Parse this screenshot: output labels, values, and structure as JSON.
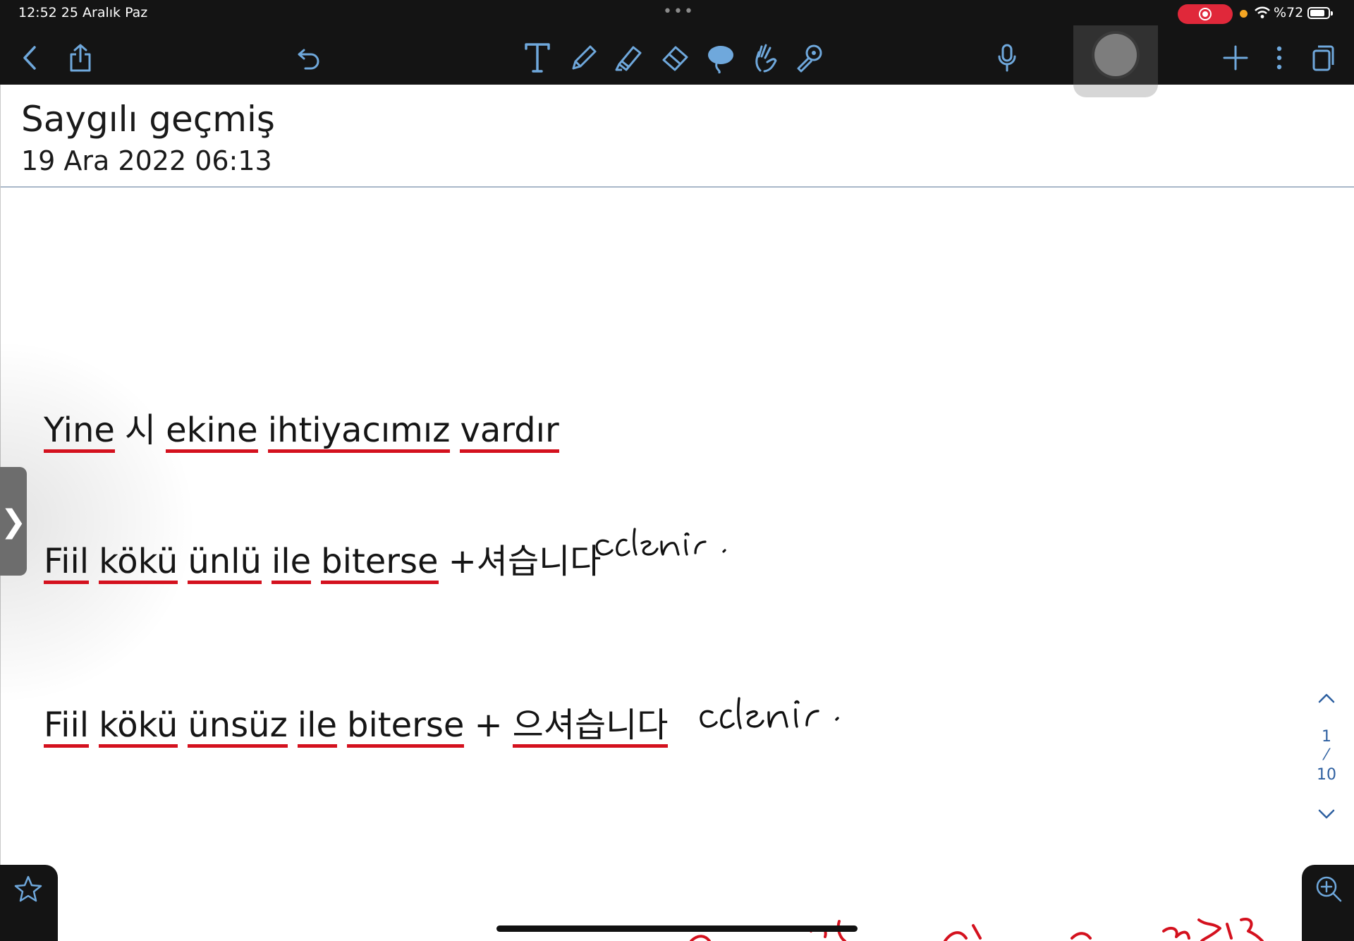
{
  "status_bar": {
    "time_date": "12:52   25 Aralık Paz",
    "dots": "•••",
    "battery": "%72"
  },
  "toolbar": {
    "icons": [
      "chevron-left-icon",
      "share-icon",
      "undo-icon",
      "text-tool-icon",
      "pen-icon",
      "highlighter-icon",
      "eraser-icon",
      "lasso-icon",
      "hand-icon",
      "laser-pointer-icon",
      "microphone-icon",
      "plus-icon",
      "more-icon",
      "pages-icon"
    ],
    "accent": "#6fa8dc"
  },
  "note": {
    "title": "Saygılı geçmiş",
    "date": "19 Ara 2022 06:13"
  },
  "side_handle": {
    "label": "❯"
  },
  "content": {
    "line1": {
      "w1": "Yine",
      "w2": "시",
      "w3": "ekine",
      "w4": "ihtiyacımız",
      "w5": "vardır"
    },
    "line2": {
      "w1": "Fiil",
      "w2": "kökü",
      "w3": "ünlü",
      "w4": "ile",
      "w5": "biterse",
      "w6": "+셔습니다"
    },
    "line3": {
      "w1": "Fiil",
      "w2": "kökü",
      "w3": "ünsüz",
      "w4": "ile",
      "w5": "biterse",
      "w6": "+",
      "w7": "으셔습니다"
    },
    "handwritten_note_1": "eklenir.",
    "handwritten_note_2": "eklenir."
  },
  "page_nav": {
    "current": "1",
    "separator": "⁄",
    "total": "10"
  },
  "colors": {
    "toolbar_bg": "#141414",
    "underline": "#d4111e",
    "page_nav": "#2d5fa0",
    "record": "#e0283a"
  }
}
